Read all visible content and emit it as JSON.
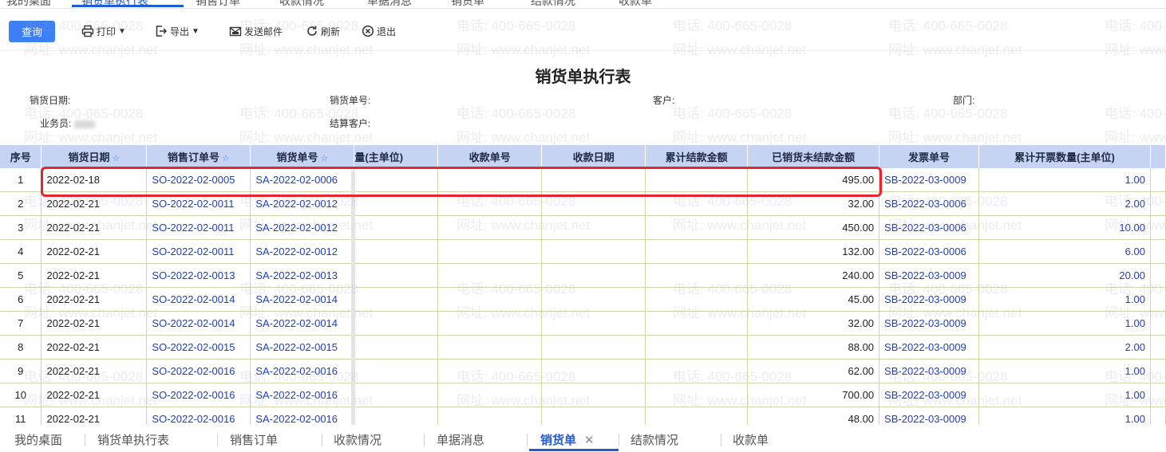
{
  "top_tabs": [
    "我的桌面",
    "销货单执行表",
    "销售订单",
    "收款情况",
    "单据消息",
    "销货单",
    "结款情况",
    "收款单"
  ],
  "toolbar": {
    "query_label": "查询",
    "print_label": "打印",
    "export_label": "导出",
    "email_label": "发送邮件",
    "refresh_label": "刷新",
    "exit_label": "退出"
  },
  "report": {
    "title": "销货单执行表",
    "filters": {
      "date_label": "销货日期:",
      "bill_no_label": "销货单号:",
      "customer_label": "客户:",
      "dept_label": "部门:",
      "salesman_label": "业务员:",
      "settle_customer_label": "结算客户:"
    }
  },
  "table": {
    "columns": [
      "序号",
      "销货日期",
      "销售订单号",
      "销货单号",
      "量(主单位)",
      "收款单号",
      "收款日期",
      "累计结款金额",
      "已销货未结款金额",
      "发票单号",
      "累计开票数量(主单位)"
    ],
    "rows": [
      [
        "1",
        "2022-02-18",
        "SO-2022-02-0005",
        "SA-2022-02-0006",
        "",
        "",
        "",
        "",
        "495.00",
        "SB-2022-03-0009",
        "1.00"
      ],
      [
        "2",
        "2022-02-21",
        "SO-2022-02-0011",
        "SA-2022-02-0012",
        "",
        "",
        "",
        "",
        "32.00",
        "SB-2022-03-0006",
        "2.00"
      ],
      [
        "3",
        "2022-02-21",
        "SO-2022-02-0011",
        "SA-2022-02-0012",
        "",
        "",
        "",
        "",
        "450.00",
        "SB-2022-03-0006",
        "10.00"
      ],
      [
        "4",
        "2022-02-21",
        "SO-2022-02-0011",
        "SA-2022-02-0012",
        "",
        "",
        "",
        "",
        "132.00",
        "SB-2022-03-0006",
        "6.00"
      ],
      [
        "5",
        "2022-02-21",
        "SO-2022-02-0013",
        "SA-2022-02-0013",
        "",
        "",
        "",
        "",
        "240.00",
        "SB-2022-03-0009",
        "20.00"
      ],
      [
        "6",
        "2022-02-21",
        "SO-2022-02-0014",
        "SA-2022-02-0014",
        "",
        "",
        "",
        "",
        "45.00",
        "SB-2022-03-0009",
        "1.00"
      ],
      [
        "7",
        "2022-02-21",
        "SO-2022-02-0014",
        "SA-2022-02-0014",
        "",
        "",
        "",
        "",
        "32.00",
        "SB-2022-03-0009",
        "1.00"
      ],
      [
        "8",
        "2022-02-21",
        "SO-2022-02-0015",
        "SA-2022-02-0015",
        "",
        "",
        "",
        "",
        "88.00",
        "SB-2022-03-0009",
        "2.00"
      ],
      [
        "9",
        "2022-02-21",
        "SO-2022-02-0016",
        "SA-2022-02-0016",
        "",
        "",
        "",
        "",
        "62.00",
        "SB-2022-03-0009",
        "1.00"
      ],
      [
        "10",
        "2022-02-21",
        "SO-2022-02-0016",
        "SA-2022-02-0016",
        "",
        "",
        "",
        "",
        "700.00",
        "SB-2022-03-0009",
        "1.00"
      ],
      [
        "11",
        "2022-02-21",
        "SO-2022-02-0016",
        "SA-2022-02-0016",
        "",
        "",
        "",
        "",
        "48.00",
        "SB-2022-03-0009",
        "1.00"
      ]
    ]
  },
  "watermark": {
    "phone": "电话: 400-665-0028",
    "site": "网址: www.chanjet.net"
  },
  "bottom_tabs": [
    "我的桌面",
    "销货单执行表",
    "销售订单",
    "收款情况",
    "单据消息",
    "销货单",
    "结款情况",
    "收款单"
  ],
  "bottom_active": "销货单",
  "colors": {
    "accent": "#3d7ff5",
    "header_bg": "#c7d3f2",
    "grid_line": "#cfd7a8",
    "link": "#1f3fb8",
    "highlight": "#e5262f"
  }
}
